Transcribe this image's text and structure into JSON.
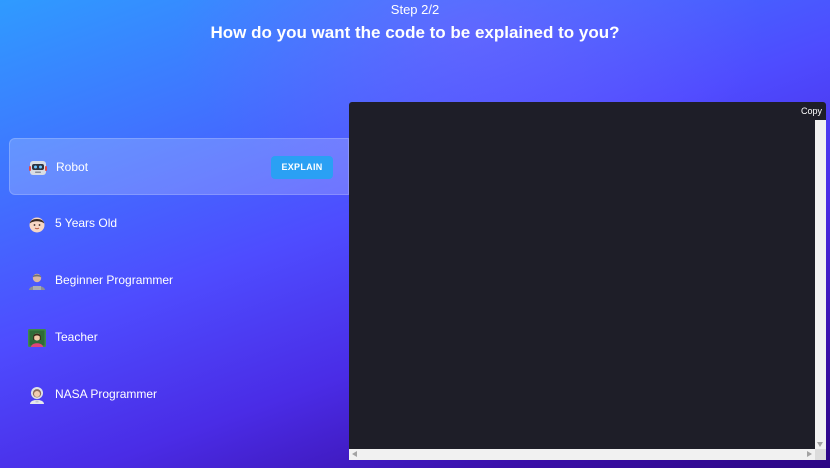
{
  "header": {
    "step": "Step 2/2",
    "title": "How do you want the code to be explained to you?"
  },
  "options": [
    {
      "label": "Robot",
      "icon": "robot-icon",
      "selected": true
    },
    {
      "label": "5 Years Old",
      "icon": "child-face-icon",
      "selected": false
    },
    {
      "label": "Beginner Programmer",
      "icon": "person-icon",
      "selected": false
    },
    {
      "label": "Teacher",
      "icon": "teacher-icon",
      "selected": false
    },
    {
      "label": "NASA Programmer",
      "icon": "astronaut-icon",
      "selected": false
    }
  ],
  "explain_button": {
    "label": "EXPLAIN"
  },
  "code_panel": {
    "copy_label": "Copy",
    "content": ""
  },
  "colors": {
    "gradient_start": "#2f9bff",
    "gradient_end": "#2c0683",
    "accent_button": "#2aa0f4",
    "code_background": "#1e1e28"
  }
}
